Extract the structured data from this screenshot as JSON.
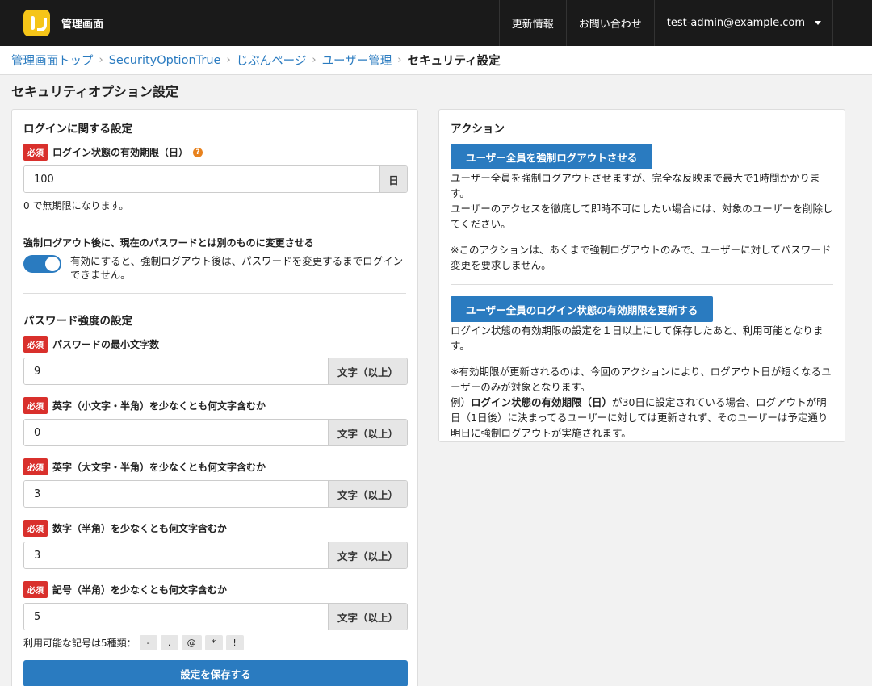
{
  "header": {
    "app_title": "管理画面",
    "nav": [
      "更新情報",
      "お問い合わせ"
    ],
    "account": "test-admin@example.com"
  },
  "breadcrumb": {
    "items": [
      "管理画面トップ",
      "SecurityOptionTrue",
      "じぶんページ",
      "ユーザー管理"
    ],
    "current": "セキュリティ設定"
  },
  "page_title": "セキュリティオプション設定",
  "left": {
    "login_section_title": "ログインに関する設定",
    "required_badge": "必須",
    "login_expiry": {
      "label": "ログイン状態の有効期限（日）",
      "help": "?",
      "value": "100",
      "unit": "日",
      "hint": "0 で無期限になります。"
    },
    "force_change": {
      "label": "強制ログアウト後に、現在のパスワードとは別のものに変更させる",
      "description": "有効にすると、強制ログアウト後は、パスワードを変更するまでログインできません。",
      "enabled": true
    },
    "password_section_title": "パスワード強度の設定",
    "unit_min": "文字（以上）",
    "fields": [
      {
        "label": "パスワードの最小文字数",
        "value": "9"
      },
      {
        "label": "英字（小文字・半角）を少なくとも何文字含むか",
        "value": "0"
      },
      {
        "label": "英字（大文字・半角）を少なくとも何文字含むか",
        "value": "3"
      },
      {
        "label": "数字（半角）を少なくとも何文字含むか",
        "value": "3"
      },
      {
        "label": "記号（半角）を少なくとも何文字含むか",
        "value": "5"
      }
    ],
    "symbols_label": "利用可能な記号は5種類：",
    "symbols": [
      "-",
      ".",
      "@",
      "*",
      "!"
    ],
    "save_button": "設定を保存する"
  },
  "right": {
    "title": "アクション",
    "force_logout_button": "ユーザー全員を強制ログアウトさせる",
    "force_logout_text1": "ユーザー全員を強制ログアウトさせますが、完全な反映まで最大で1時間かかります。",
    "force_logout_text2": "ユーザーのアクセスを徹底して即時不可にしたい場合には、対象のユーザーを削除してください。",
    "force_logout_note": "※このアクションは、あくまで強制ログアウトのみで、ユーザーに対してパスワード変更を要求しません。",
    "update_expiry_button": "ユーザー全員のログイン状態の有効期限を更新する",
    "update_expiry_text": "ログイン状態の有効期限の設定を１日以上にして保存したあと、利用可能となります。",
    "update_expiry_note1": "※有効期限が更新されるのは、今回のアクションにより、ログアウト日が短くなるユーザーのみが対象となります。",
    "example_prefix": "例）",
    "example_bold": "ログイン状態の有効期限（日）",
    "example_rest": "が30日に設定されている場合、ログアウトが明日（1日後）に決まってるユーザーに対しては更新されず、そのユーザーは予定通り明日に強制ログアウトが実施されます。"
  }
}
